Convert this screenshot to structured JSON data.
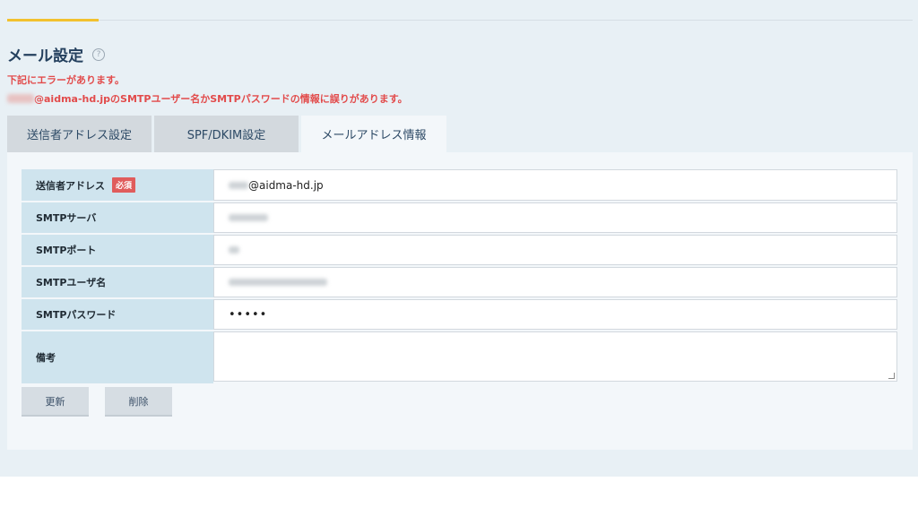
{
  "header": {
    "title": "メール設定",
    "help_icon": "?",
    "error_line1": "下記にエラーがあります。",
    "error_line2": "@aidma-hd.jpのSMTPユーザー名かSMTPパスワードの情報に誤りがあります。"
  },
  "tabs": [
    {
      "label": "送信者アドレス設定",
      "active": false
    },
    {
      "label": "SPF/DKIM設定",
      "active": false
    },
    {
      "label": "メールアドレス情報",
      "active": true
    }
  ],
  "form": {
    "sender_label": "送信者アドレス",
    "required_badge": "必須",
    "sender_value": "@aidma-hd.jp",
    "smtp_server_label": "SMTPサーバ",
    "smtp_port_label": "SMTPポート",
    "smtp_user_label": "SMTPユーザ名",
    "smtp_password_label": "SMTPパスワード",
    "smtp_password_value": "•••••",
    "notes_label": "備考"
  },
  "buttons": {
    "update": "更新",
    "delete": "削除"
  },
  "colors": {
    "accent": "#f2c12e",
    "error": "#e24b4b",
    "label_bg": "#cfe4ee",
    "required_bg": "#e05c5c"
  }
}
